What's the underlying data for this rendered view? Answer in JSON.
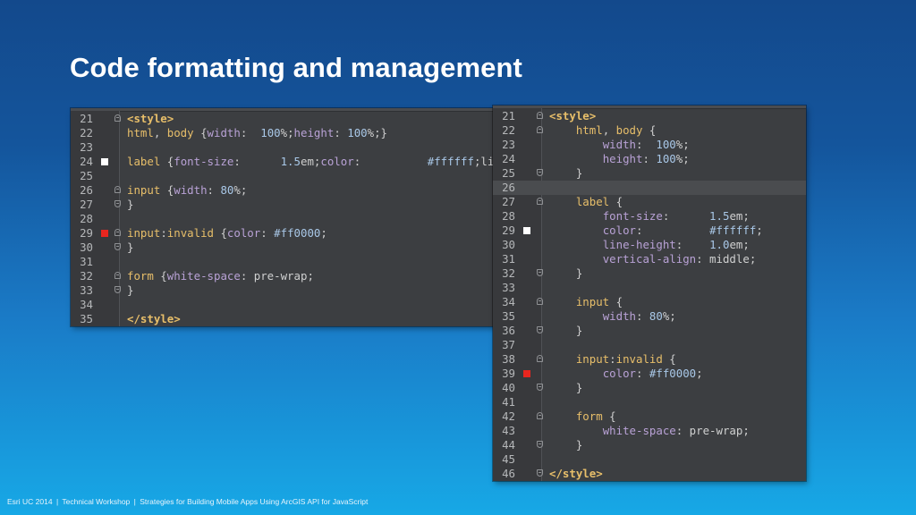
{
  "slide": {
    "title": "Code formatting and management"
  },
  "footer": {
    "event": "Esri UC 2014",
    "workshop": "Technical Workshop",
    "session": "Strategies for Building Mobile Apps Using ArcGIS API for JavaScript"
  },
  "colors": {
    "tag": "#e8bf6a",
    "property": "#b9a2d6",
    "value": "#a9c8e8",
    "editor_background": "#3c3e41",
    "warning_marker": "#ffffff",
    "error_marker": "#e8261f"
  },
  "editors": {
    "left": {
      "lines": [
        {
          "num": "21",
          "fold": "open",
          "tokens": [
            [
              "tag",
              "<style>"
            ]
          ]
        },
        {
          "num": "22",
          "tokens": [
            [
              "sel",
              "html"
            ],
            [
              "punc",
              ", "
            ],
            [
              "sel",
              "body"
            ],
            [
              "punc",
              " {"
            ],
            [
              "prop",
              "width"
            ],
            [
              "punc",
              ":  "
            ],
            [
              "val",
              "100"
            ],
            [
              "punc",
              "%;"
            ],
            [
              "prop",
              "height"
            ],
            [
              "punc",
              ": "
            ],
            [
              "val",
              "100"
            ],
            [
              "punc",
              "%;}"
            ]
          ]
        },
        {
          "num": "23",
          "tokens": []
        },
        {
          "num": "24",
          "marker": "warn",
          "tokens": [
            [
              "sel",
              "label"
            ],
            [
              "punc",
              " {"
            ],
            [
              "prop",
              "font-size"
            ],
            [
              "punc",
              ":      "
            ],
            [
              "val",
              "1.5"
            ],
            [
              "punc",
              "em;"
            ],
            [
              "prop",
              "color"
            ],
            [
              "punc",
              ":          "
            ],
            [
              "val",
              "#ffffff"
            ],
            [
              "punc",
              ";li"
            ]
          ]
        },
        {
          "num": "25",
          "tokens": []
        },
        {
          "num": "26",
          "fold": "open",
          "tokens": [
            [
              "sel",
              "input"
            ],
            [
              "punc",
              " {"
            ],
            [
              "prop",
              "width"
            ],
            [
              "punc",
              ": "
            ],
            [
              "val",
              "80"
            ],
            [
              "punc",
              "%;"
            ]
          ]
        },
        {
          "num": "27",
          "fold": "close",
          "tokens": [
            [
              "punc",
              "}"
            ]
          ]
        },
        {
          "num": "28",
          "tokens": []
        },
        {
          "num": "29",
          "marker": "err",
          "fold": "open",
          "tokens": [
            [
              "sel",
              "input"
            ],
            [
              "punc",
              ":"
            ],
            [
              "sel",
              "invalid"
            ],
            [
              "punc",
              " {"
            ],
            [
              "prop",
              "color"
            ],
            [
              "punc",
              ": "
            ],
            [
              "val",
              "#ff0000"
            ],
            [
              "punc",
              ";"
            ]
          ]
        },
        {
          "num": "30",
          "fold": "close",
          "tokens": [
            [
              "punc",
              "}"
            ]
          ]
        },
        {
          "num": "31",
          "tokens": []
        },
        {
          "num": "32",
          "fold": "open",
          "tokens": [
            [
              "sel",
              "form"
            ],
            [
              "punc",
              " {"
            ],
            [
              "prop",
              "white-space"
            ],
            [
              "punc",
              ": "
            ],
            [
              "kw",
              "pre-wrap"
            ],
            [
              "punc",
              ";"
            ]
          ]
        },
        {
          "num": "33",
          "fold": "close",
          "tokens": [
            [
              "punc",
              "}"
            ]
          ]
        },
        {
          "num": "34",
          "tokens": []
        },
        {
          "num": "35",
          "tokens": [
            [
              "tag",
              "</style>"
            ]
          ]
        }
      ]
    },
    "right": {
      "lines": [
        {
          "num": "21",
          "fold": "open",
          "tokens": [
            [
              "tag",
              "<style>"
            ]
          ]
        },
        {
          "num": "22",
          "fold": "open",
          "tokens": [
            [
              "punc",
              "    "
            ],
            [
              "sel",
              "html"
            ],
            [
              "punc",
              ", "
            ],
            [
              "sel",
              "body"
            ],
            [
              "punc",
              " {"
            ]
          ]
        },
        {
          "num": "23",
          "tokens": [
            [
              "punc",
              "        "
            ],
            [
              "prop",
              "width"
            ],
            [
              "punc",
              ":  "
            ],
            [
              "val",
              "100"
            ],
            [
              "punc",
              "%;"
            ]
          ]
        },
        {
          "num": "24",
          "tokens": [
            [
              "punc",
              "        "
            ],
            [
              "prop",
              "height"
            ],
            [
              "punc",
              ": "
            ],
            [
              "val",
              "100"
            ],
            [
              "punc",
              "%;"
            ]
          ]
        },
        {
          "num": "25",
          "fold": "close",
          "tokens": [
            [
              "punc",
              "    }"
            ]
          ]
        },
        {
          "num": "26",
          "current": true,
          "tokens": []
        },
        {
          "num": "27",
          "fold": "open",
          "tokens": [
            [
              "punc",
              "    "
            ],
            [
              "sel",
              "label"
            ],
            [
              "punc",
              " {"
            ]
          ]
        },
        {
          "num": "28",
          "tokens": [
            [
              "punc",
              "        "
            ],
            [
              "prop",
              "font-size"
            ],
            [
              "punc",
              ":      "
            ],
            [
              "val",
              "1.5"
            ],
            [
              "punc",
              "em;"
            ]
          ]
        },
        {
          "num": "29",
          "marker": "warn",
          "tokens": [
            [
              "punc",
              "        "
            ],
            [
              "prop",
              "color"
            ],
            [
              "punc",
              ":          "
            ],
            [
              "val",
              "#ffffff"
            ],
            [
              "punc",
              ";"
            ]
          ]
        },
        {
          "num": "30",
          "tokens": [
            [
              "punc",
              "        "
            ],
            [
              "prop",
              "line-height"
            ],
            [
              "punc",
              ":    "
            ],
            [
              "val",
              "1.0"
            ],
            [
              "punc",
              "em;"
            ]
          ]
        },
        {
          "num": "31",
          "tokens": [
            [
              "punc",
              "        "
            ],
            [
              "prop",
              "vertical-align"
            ],
            [
              "punc",
              ": "
            ],
            [
              "kw",
              "middle"
            ],
            [
              "punc",
              ";"
            ]
          ]
        },
        {
          "num": "32",
          "fold": "close",
          "tokens": [
            [
              "punc",
              "    }"
            ]
          ]
        },
        {
          "num": "33",
          "tokens": []
        },
        {
          "num": "34",
          "fold": "open",
          "tokens": [
            [
              "punc",
              "    "
            ],
            [
              "sel",
              "input"
            ],
            [
              "punc",
              " {"
            ]
          ]
        },
        {
          "num": "35",
          "tokens": [
            [
              "punc",
              "        "
            ],
            [
              "prop",
              "width"
            ],
            [
              "punc",
              ": "
            ],
            [
              "val",
              "80"
            ],
            [
              "punc",
              "%;"
            ]
          ]
        },
        {
          "num": "36",
          "fold": "close",
          "tokens": [
            [
              "punc",
              "    }"
            ]
          ]
        },
        {
          "num": "37",
          "tokens": []
        },
        {
          "num": "38",
          "fold": "open",
          "tokens": [
            [
              "punc",
              "    "
            ],
            [
              "sel",
              "input"
            ],
            [
              "punc",
              ":"
            ],
            [
              "sel",
              "invalid"
            ],
            [
              "punc",
              " {"
            ]
          ]
        },
        {
          "num": "39",
          "marker": "err",
          "tokens": [
            [
              "punc",
              "        "
            ],
            [
              "prop",
              "color"
            ],
            [
              "punc",
              ": "
            ],
            [
              "val",
              "#ff0000"
            ],
            [
              "punc",
              ";"
            ]
          ]
        },
        {
          "num": "40",
          "fold": "close",
          "tokens": [
            [
              "punc",
              "    }"
            ]
          ]
        },
        {
          "num": "41",
          "tokens": []
        },
        {
          "num": "42",
          "fold": "open",
          "tokens": [
            [
              "punc",
              "    "
            ],
            [
              "sel",
              "form"
            ],
            [
              "punc",
              " {"
            ]
          ]
        },
        {
          "num": "43",
          "tokens": [
            [
              "punc",
              "        "
            ],
            [
              "prop",
              "white-space"
            ],
            [
              "punc",
              ": "
            ],
            [
              "kw",
              "pre-wrap"
            ],
            [
              "punc",
              ";"
            ]
          ]
        },
        {
          "num": "44",
          "fold": "close",
          "tokens": [
            [
              "punc",
              "    }"
            ]
          ]
        },
        {
          "num": "45",
          "tokens": []
        },
        {
          "num": "46",
          "fold": "close",
          "tokens": [
            [
              "tag",
              "</style>"
            ]
          ]
        }
      ]
    }
  }
}
